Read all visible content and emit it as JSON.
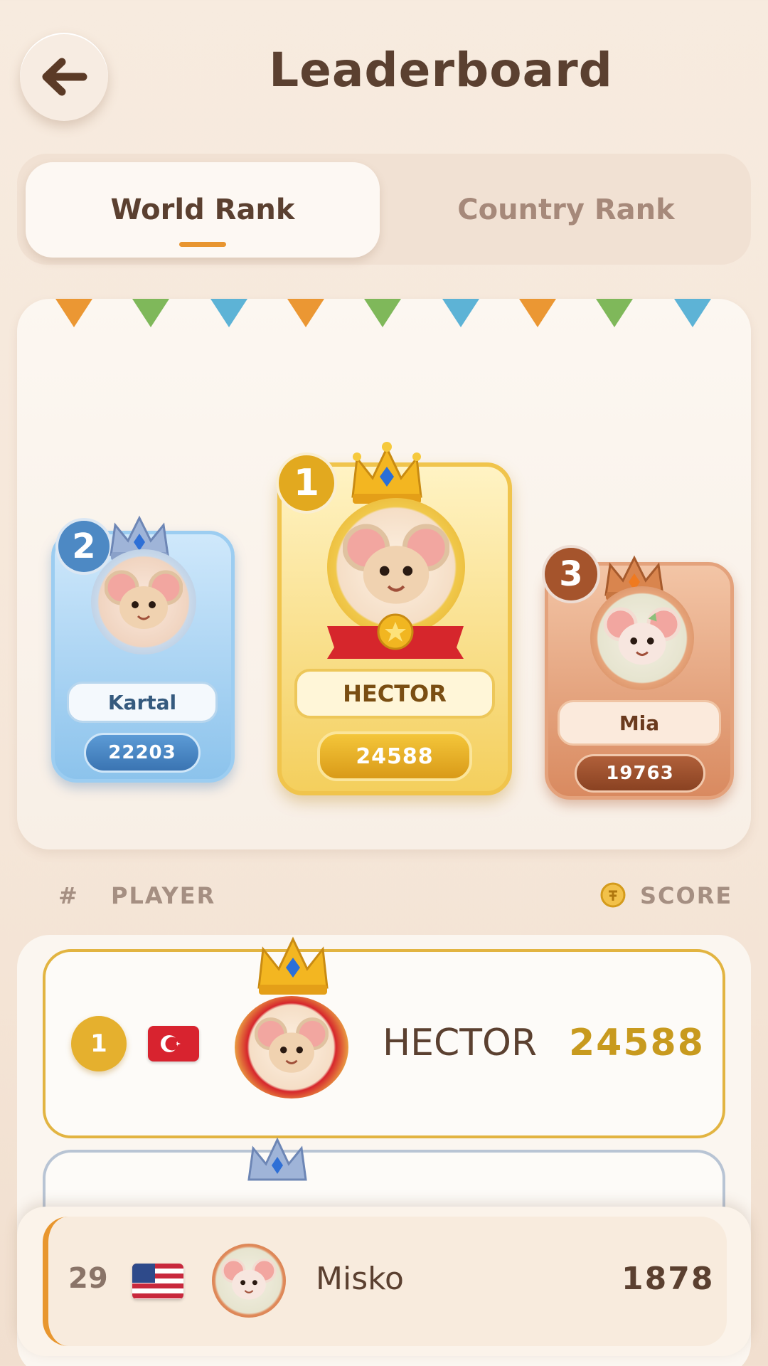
{
  "header": {
    "title": "Leaderboard",
    "back_icon": "arrow-left-icon"
  },
  "tabs": [
    {
      "label": "World Rank",
      "active": true
    },
    {
      "label": "Country Rank",
      "active": false
    }
  ],
  "podium": [
    {
      "rank": "2",
      "name": "Kartal",
      "score": "22203",
      "tier": "silver"
    },
    {
      "rank": "1",
      "name": "HECTOR",
      "score": "24588",
      "tier": "gold"
    },
    {
      "rank": "3",
      "name": "Mia",
      "score": "19763",
      "tier": "bronze"
    }
  ],
  "list_header": {
    "rank_col": "#",
    "player_col": "PLAYER",
    "score_col": "SCORE",
    "coin_icon": "coin-icon"
  },
  "rows": [
    {
      "rank": "1",
      "country": "Turkey",
      "flag": "turkey-flag",
      "name": "HECTOR",
      "score": "24588"
    }
  ],
  "current_player": {
    "rank": "29",
    "country": "United States",
    "flag": "us-flag",
    "name": "Misko",
    "score": "1878"
  },
  "colors": {
    "accent": "#e8962e",
    "gold": "#c89a1e",
    "text": "#5b4030",
    "muted": "#a58f82"
  }
}
